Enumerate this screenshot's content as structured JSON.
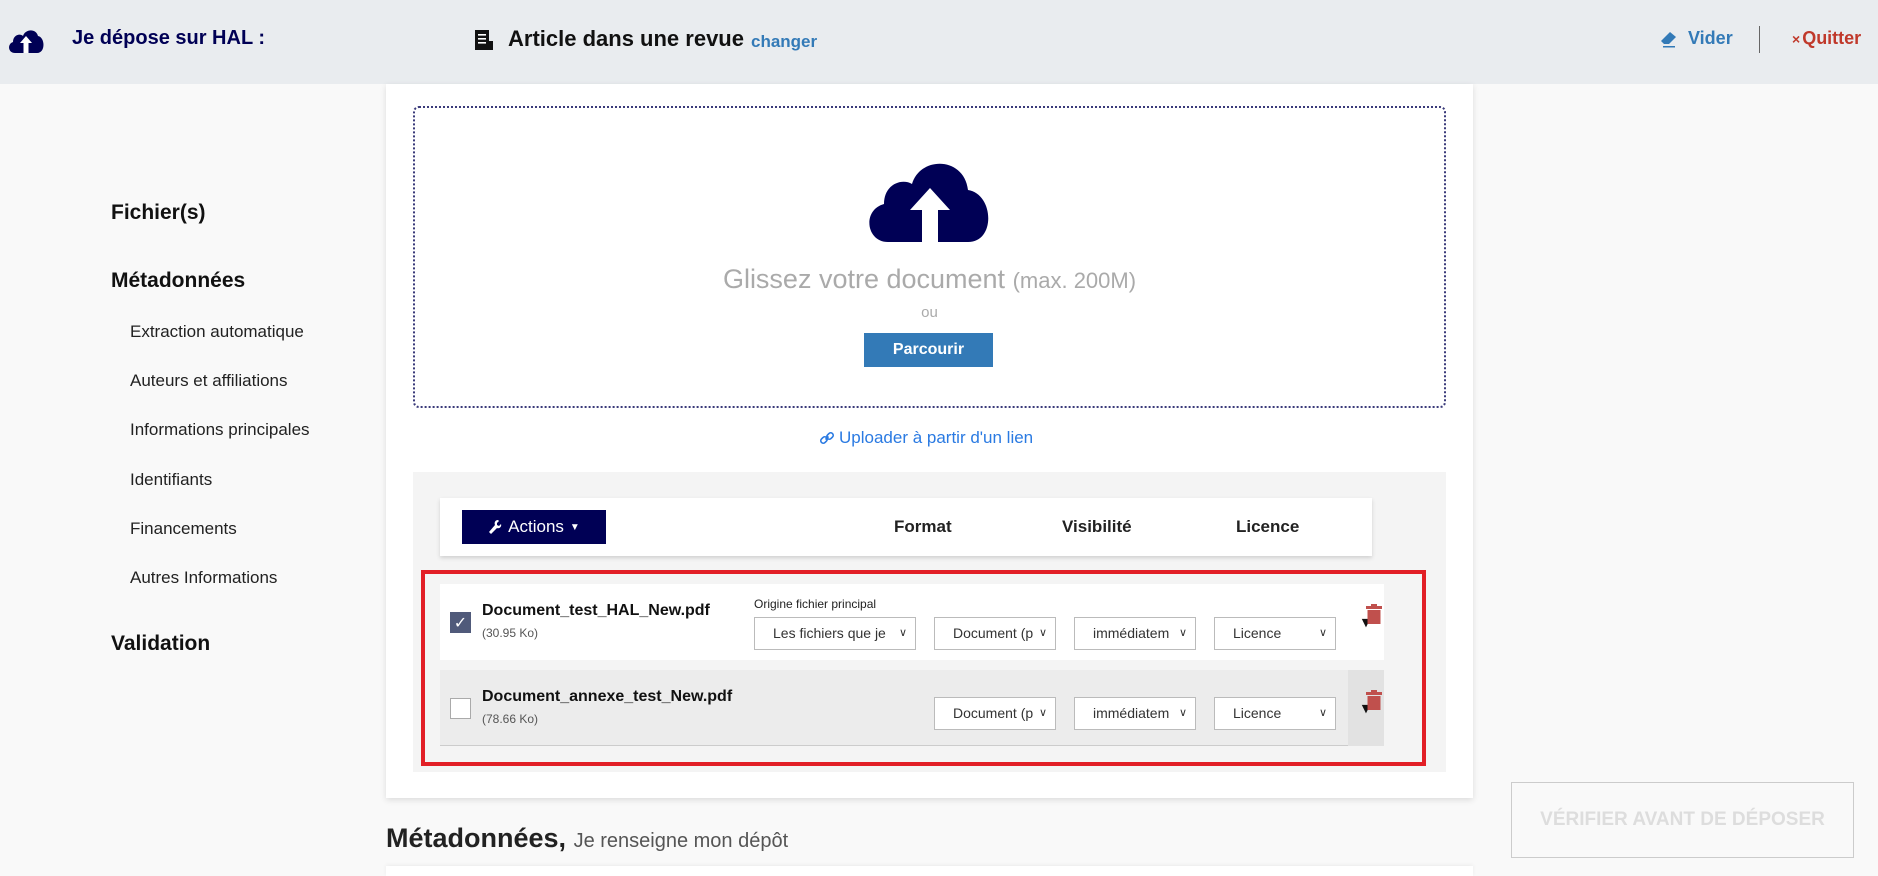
{
  "header": {
    "logo_icon": "cloud-upload-icon",
    "title": "Je dépose sur HAL :",
    "doc_icon": "document-icon",
    "doc_type": "Article dans une revue",
    "change_label": "changer",
    "clear_icon": "eraser-icon",
    "clear_label": "Vider",
    "quit_symbol": "×",
    "quit_label": "Quitter"
  },
  "sidebar": {
    "sections": [
      {
        "label": "Fichier(s)"
      },
      {
        "label": "Métadonnées",
        "items": [
          "Extraction automatique",
          "Auteurs et affiliations",
          "Informations principales",
          "Identifiants",
          "Financements",
          "Autres Informations"
        ]
      },
      {
        "label": "Validation"
      }
    ]
  },
  "upload": {
    "drop_text": "Glissez votre document",
    "max_text": "(max. 200M)",
    "or_text": "ou",
    "browse_label": "Parcourir",
    "link_label": "Uploader à partir d'un lien"
  },
  "files": {
    "actions_label": "Actions",
    "columns": [
      "Format",
      "Visibilité",
      "Licence"
    ],
    "origin_label": "Origine fichier principal",
    "rows": [
      {
        "name": "Document_test_HAL_New.pdf",
        "size": "(30.95 Ko)",
        "checked": true,
        "origin": "Les fichiers que je",
        "format": "Document (p",
        "visibility": "immédiatem",
        "licence": "Licence"
      },
      {
        "name": "Document_annexe_test_New.pdf",
        "size": "(78.66 Ko)",
        "checked": false,
        "format": "Document (p",
        "visibility": "immédiatem",
        "licence": "Licence"
      }
    ]
  },
  "metadata": {
    "title": "Métadonnées,",
    "subtitle": "Je renseigne mon dépôt"
  },
  "verify_label": "VÉRIFIER AVANT DE DÉPOSER",
  "colors": {
    "brand_navy": "#000055",
    "link_blue": "#337ab7",
    "danger_red": "#c0392b",
    "highlight_red": "#e21f26"
  }
}
